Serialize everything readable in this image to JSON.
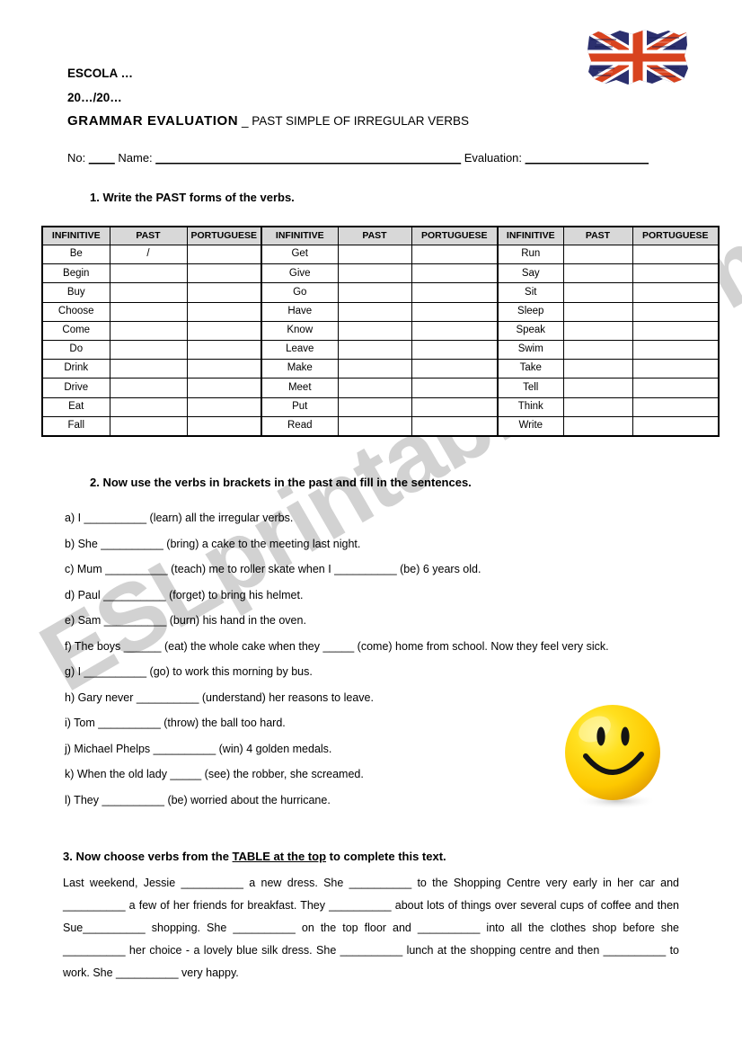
{
  "header": {
    "school": "ESCOLA …",
    "year": "20…/20…",
    "title_bold": "GRAMMAR EVALUATION",
    "title_rest": " _ PAST SIMPLE OF IRREGULAR VERBS",
    "number_label": "No: ",
    "number_blank": "____",
    "name_label": "  Name: ",
    "name_blank": "_______________________________________________",
    "evaluation_label": "  Evaluation: ",
    "evaluation_blank": "___________________"
  },
  "flag": {
    "name": "uk-flag",
    "blue": "#2b2f6e",
    "red": "#d8431f",
    "white": "#ffffff"
  },
  "watermark": {
    "text": "ESLprintables.com",
    "color": "#d2d2d2"
  },
  "task1": {
    "heading": "1.   Write the PAST forms of the verbs.",
    "columns": [
      "INFINITIVE",
      "PAST",
      "PORTUGUESE",
      "INFINITIVE",
      "PAST",
      "PORTUGUESE",
      "INFINITIVE",
      "PAST",
      "PORTUGUESE"
    ],
    "rows": [
      {
        "v1": "Be",
        "p1": "/",
        "q1": "",
        "v2": "Get",
        "p2": "",
        "q2": "",
        "v3": "Run",
        "p3": "",
        "q3": ""
      },
      {
        "v1": "Begin",
        "p1": "",
        "q1": "",
        "v2": "Give",
        "p2": "",
        "q2": "",
        "v3": "Say",
        "p3": "",
        "q3": ""
      },
      {
        "v1": "Buy",
        "p1": "",
        "q1": "",
        "v2": "Go",
        "p2": "",
        "q2": "",
        "v3": "Sit",
        "p3": "",
        "q3": ""
      },
      {
        "v1": "Choose",
        "p1": "",
        "q1": "",
        "v2": "Have",
        "p2": "",
        "q2": "",
        "v3": "Sleep",
        "p3": "",
        "q3": ""
      },
      {
        "v1": "Come",
        "p1": "",
        "q1": "",
        "v2": "Know",
        "p2": "",
        "q2": "",
        "v3": "Speak",
        "p3": "",
        "q3": ""
      },
      {
        "v1": "Do",
        "p1": "",
        "q1": "",
        "v2": "Leave",
        "p2": "",
        "q2": "",
        "v3": "Swim",
        "p3": "",
        "q3": ""
      },
      {
        "v1": "Drink",
        "p1": "",
        "q1": "",
        "v2": "Make",
        "p2": "",
        "q2": "",
        "v3": "Take",
        "p3": "",
        "q3": ""
      },
      {
        "v1": "Drive",
        "p1": "",
        "q1": "",
        "v2": "Meet",
        "p2": "",
        "q2": "",
        "v3": "Tell",
        "p3": "",
        "q3": ""
      },
      {
        "v1": "Eat",
        "p1": "",
        "q1": "",
        "v2": "Put",
        "p2": "",
        "q2": "",
        "v3": "Think",
        "p3": "",
        "q3": ""
      },
      {
        "v1": "Fall",
        "p1": "",
        "q1": "",
        "v2": "Read",
        "p2": "",
        "q2": "",
        "v3": "Write",
        "p3": "",
        "q3": ""
      }
    ]
  },
  "task2": {
    "heading": "2.    Now use the verbs in brackets in the past and fill in the sentences.",
    "sentences": [
      "a) I __________ (learn) all the irregular verbs.",
      "b) She __________ (bring) a cake to the meeting last night.",
      "c) Mum __________ (teach) me to roller skate when I __________ (be) 6 years old.",
      "d)  Paul __________ (forget) to bring his helmet.",
      "e) Sam __________ (burn) his hand in the oven.",
      "f) The boys ______ (eat) the whole cake when they _____ (come) home from school. Now they feel very sick.",
      "g) I __________ (go) to work this morning by bus.",
      "h) Gary never __________ (understand) her reasons to leave.",
      "i) Tom __________ (throw) the ball too hard.",
      "j) Michael Phelps __________  (win) 4 golden medals.",
      "k) When the old lady _____ (see) the robber, she screamed.",
      "l) They __________ (be) worried about the hurricane."
    ]
  },
  "task3": {
    "heading_pre": "3. Now choose verbs from the ",
    "heading_underline": "TABLE at the top",
    "heading_post": " to complete this text.",
    "text": "Last weekend, Jessie __________ a new dress. She __________ to the Shopping Centre very early in her car and __________ a few of her friends for breakfast. They __________ about lots of things over several cups of coffee and then Sue__________ shopping. She __________ on the top floor and __________ into all the clothes shop before she __________ her choice - a lovely blue silk dress.   She __________ lunch at the shopping centre and then __________ to work. She __________ very happy."
  },
  "smiley": {
    "name": "smiley-face",
    "body": "#ffd900",
    "shade": "#e8a800",
    "features": "#1a1a1a"
  }
}
